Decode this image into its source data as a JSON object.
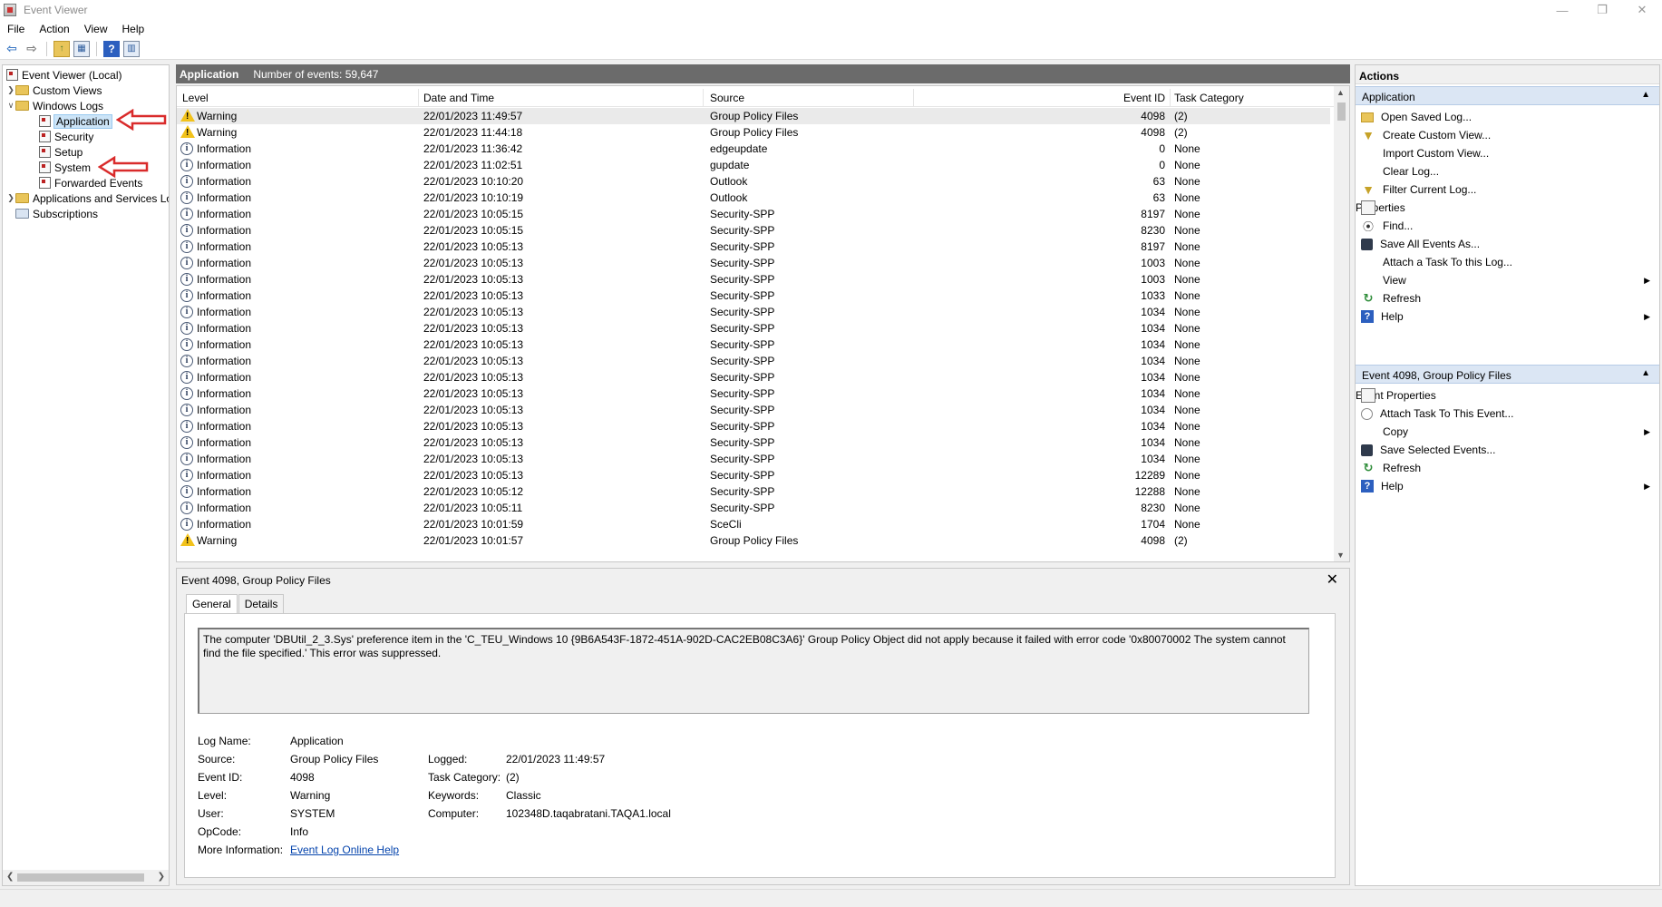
{
  "window": {
    "title": "Event Viewer",
    "minimize": "—",
    "restore": "❐",
    "close": "✕"
  },
  "menu": [
    "File",
    "Action",
    "View",
    "Help"
  ],
  "tree": {
    "root": "Event Viewer (Local)",
    "custom_views": "Custom Views",
    "windows_logs": "Windows Logs",
    "logs": [
      "Application",
      "Security",
      "Setup",
      "System",
      "Forwarded Events"
    ],
    "app_services": "Applications and Services Lo",
    "subscriptions": "Subscriptions"
  },
  "center": {
    "title": "Application",
    "count": "Number of events: 59,647"
  },
  "columns": [
    "Level",
    "Date and Time",
    "Source",
    "Event ID",
    "Task Category"
  ],
  "events": [
    {
      "level": "Warning",
      "date": "22/01/2023 11:49:57",
      "source": "Group Policy Files",
      "id": "4098",
      "task": "(2)"
    },
    {
      "level": "Warning",
      "date": "22/01/2023 11:44:18",
      "source": "Group Policy Files",
      "id": "4098",
      "task": "(2)"
    },
    {
      "level": "Information",
      "date": "22/01/2023 11:36:42",
      "source": "edgeupdate",
      "id": "0",
      "task": "None"
    },
    {
      "level": "Information",
      "date": "22/01/2023 11:02:51",
      "source": "gupdate",
      "id": "0",
      "task": "None"
    },
    {
      "level": "Information",
      "date": "22/01/2023 10:10:20",
      "source": "Outlook",
      "id": "63",
      "task": "None"
    },
    {
      "level": "Information",
      "date": "22/01/2023 10:10:19",
      "source": "Outlook",
      "id": "63",
      "task": "None"
    },
    {
      "level": "Information",
      "date": "22/01/2023 10:05:15",
      "source": "Security-SPP",
      "id": "8197",
      "task": "None"
    },
    {
      "level": "Information",
      "date": "22/01/2023 10:05:15",
      "source": "Security-SPP",
      "id": "8230",
      "task": "None"
    },
    {
      "level": "Information",
      "date": "22/01/2023 10:05:13",
      "source": "Security-SPP",
      "id": "8197",
      "task": "None"
    },
    {
      "level": "Information",
      "date": "22/01/2023 10:05:13",
      "source": "Security-SPP",
      "id": "1003",
      "task": "None"
    },
    {
      "level": "Information",
      "date": "22/01/2023 10:05:13",
      "source": "Security-SPP",
      "id": "1003",
      "task": "None"
    },
    {
      "level": "Information",
      "date": "22/01/2023 10:05:13",
      "source": "Security-SPP",
      "id": "1033",
      "task": "None"
    },
    {
      "level": "Information",
      "date": "22/01/2023 10:05:13",
      "source": "Security-SPP",
      "id": "1034",
      "task": "None"
    },
    {
      "level": "Information",
      "date": "22/01/2023 10:05:13",
      "source": "Security-SPP",
      "id": "1034",
      "task": "None"
    },
    {
      "level": "Information",
      "date": "22/01/2023 10:05:13",
      "source": "Security-SPP",
      "id": "1034",
      "task": "None"
    },
    {
      "level": "Information",
      "date": "22/01/2023 10:05:13",
      "source": "Security-SPP",
      "id": "1034",
      "task": "None"
    },
    {
      "level": "Information",
      "date": "22/01/2023 10:05:13",
      "source": "Security-SPP",
      "id": "1034",
      "task": "None"
    },
    {
      "level": "Information",
      "date": "22/01/2023 10:05:13",
      "source": "Security-SPP",
      "id": "1034",
      "task": "None"
    },
    {
      "level": "Information",
      "date": "22/01/2023 10:05:13",
      "source": "Security-SPP",
      "id": "1034",
      "task": "None"
    },
    {
      "level": "Information",
      "date": "22/01/2023 10:05:13",
      "source": "Security-SPP",
      "id": "1034",
      "task": "None"
    },
    {
      "level": "Information",
      "date": "22/01/2023 10:05:13",
      "source": "Security-SPP",
      "id": "1034",
      "task": "None"
    },
    {
      "level": "Information",
      "date": "22/01/2023 10:05:13",
      "source": "Security-SPP",
      "id": "1034",
      "task": "None"
    },
    {
      "level": "Information",
      "date": "22/01/2023 10:05:13",
      "source": "Security-SPP",
      "id": "12289",
      "task": "None"
    },
    {
      "level": "Information",
      "date": "22/01/2023 10:05:12",
      "source": "Security-SPP",
      "id": "12288",
      "task": "None"
    },
    {
      "level": "Information",
      "date": "22/01/2023 10:05:11",
      "source": "Security-SPP",
      "id": "8230",
      "task": "None"
    },
    {
      "level": "Information",
      "date": "22/01/2023 10:01:59",
      "source": "SceCli",
      "id": "1704",
      "task": "None"
    },
    {
      "level": "Warning",
      "date": "22/01/2023 10:01:57",
      "source": "Group Policy Files",
      "id": "4098",
      "task": "(2)"
    }
  ],
  "detail": {
    "title": "Event 4098, Group Policy Files",
    "close": "✕",
    "tabs": [
      "General",
      "Details"
    ],
    "description": "The computer 'DBUtil_2_3.Sys' preference item in the 'C_TEU_Windows 10 {9B6A543F-1872-451A-902D-CAC2EB08C3A6}' Group Policy Object did not apply because it failed with error code '0x80070002 The system cannot find the file specified.' This error was suppressed.",
    "labels": {
      "log_name": "Log Name:",
      "source": "Source:",
      "event_id": "Event ID:",
      "level": "Level:",
      "user": "User:",
      "opcode": "OpCode:",
      "more_info": "More Information:",
      "logged": "Logged:",
      "task_category": "Task Category:",
      "keywords": "Keywords:",
      "computer": "Computer:"
    },
    "values": {
      "log_name": "Application",
      "source": "Group Policy Files",
      "event_id": "4098",
      "level": "Warning",
      "user": "SYSTEM",
      "opcode": "Info",
      "more_info": "Event Log Online Help",
      "logged": "22/01/2023 11:49:57",
      "task_category": "(2)",
      "keywords": "Classic",
      "computer": "102348D.taqabratani.TAQA1.local"
    }
  },
  "actions": {
    "header": "Actions",
    "section1": "Application",
    "items1": [
      {
        "label": "Open Saved Log...",
        "icon": "folder-icon",
        "sub": false
      },
      {
        "label": "Create Custom View...",
        "icon": "filter-icon",
        "sub": false
      },
      {
        "label": "Import Custom View...",
        "icon": "",
        "sub": false
      },
      {
        "label": "Clear Log...",
        "icon": "",
        "sub": false
      },
      {
        "label": "Filter Current Log...",
        "icon": "filter-icon",
        "sub": false
      },
      {
        "label": "Properties",
        "icon": "properties-icon",
        "sub": false
      },
      {
        "label": "Find...",
        "icon": "binoculars-icon",
        "sub": false
      },
      {
        "label": "Save All Events As...",
        "icon": "save-icon",
        "sub": false
      },
      {
        "label": "Attach a Task To this Log...",
        "icon": "",
        "sub": false
      },
      {
        "label": "View",
        "icon": "",
        "sub": true
      },
      {
        "label": "Refresh",
        "icon": "refresh-icon",
        "sub": false
      },
      {
        "label": "Help",
        "icon": "help-icon",
        "sub": true
      }
    ],
    "section2": "Event 4098, Group Policy Files",
    "items2": [
      {
        "label": "Event Properties",
        "icon": "properties-icon",
        "sub": false
      },
      {
        "label": "Attach Task To This Event...",
        "icon": "task-icon",
        "sub": false
      },
      {
        "label": "Copy",
        "icon": "copy-icon",
        "sub": true
      },
      {
        "label": "Save Selected Events...",
        "icon": "save-icon",
        "sub": false
      },
      {
        "label": "Refresh",
        "icon": "refresh-icon",
        "sub": false
      },
      {
        "label": "Help",
        "icon": "help-icon",
        "sub": true
      }
    ]
  },
  "colors": {
    "header_bg": "#6b6b6b",
    "section_bg": "#dbe6f4",
    "annotation": "#d92b2b",
    "link": "#0645ad"
  }
}
